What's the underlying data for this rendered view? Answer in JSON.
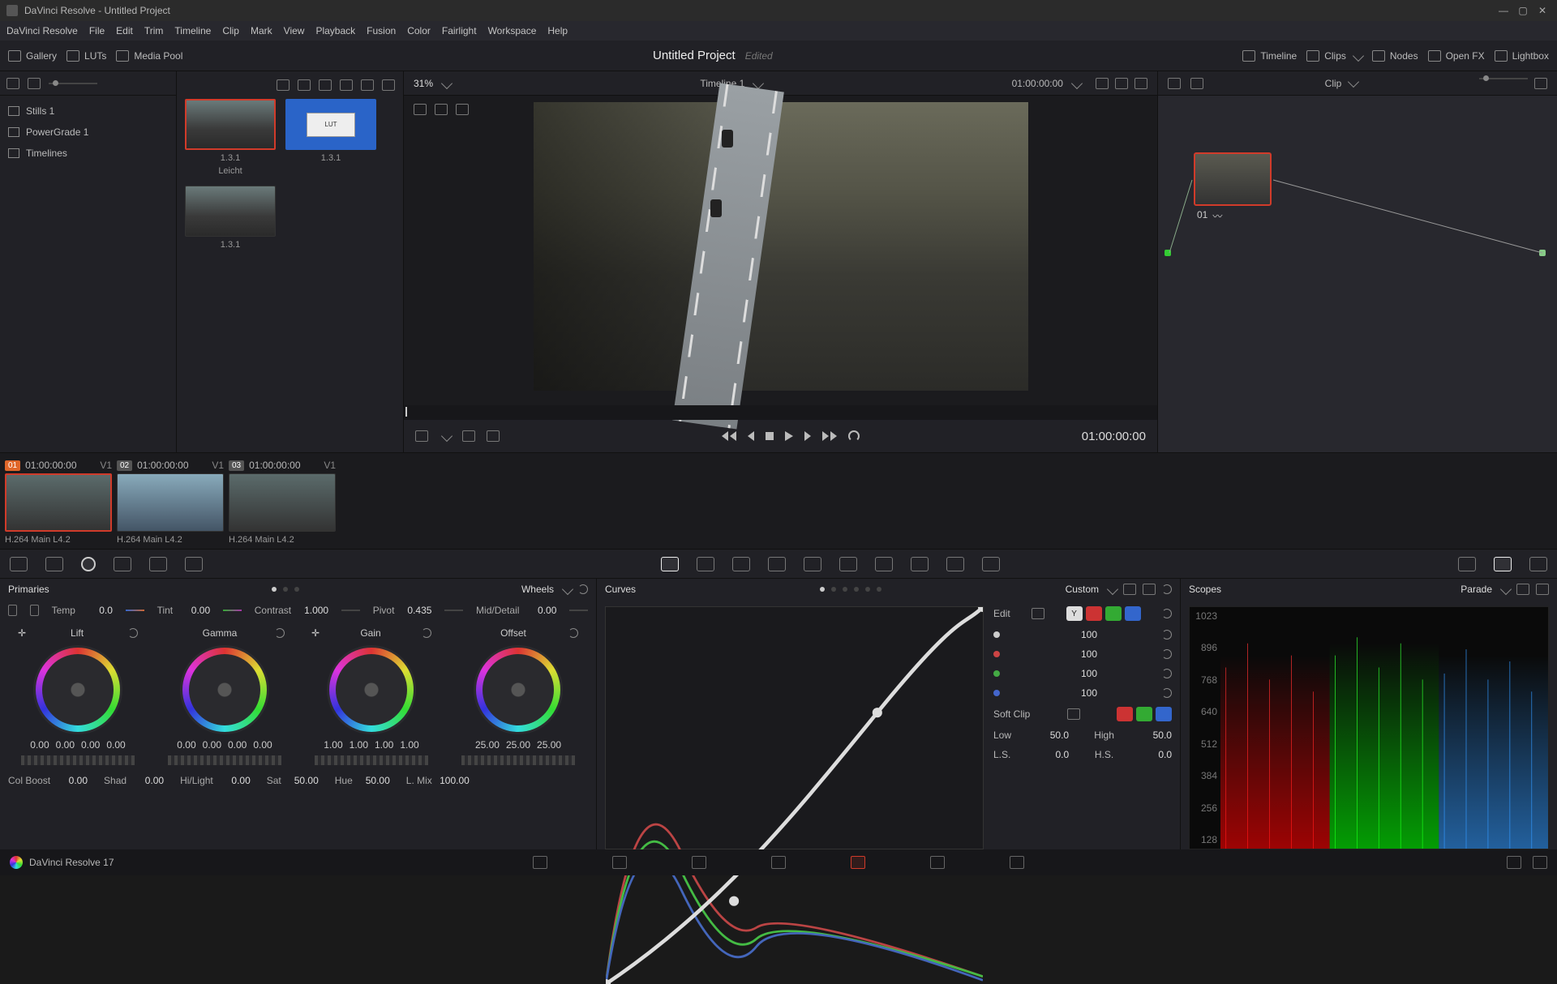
{
  "window": {
    "title": "DaVinci Resolve - Untitled Project"
  },
  "menu": [
    "DaVinci Resolve",
    "File",
    "Edit",
    "Trim",
    "Timeline",
    "Clip",
    "Mark",
    "View",
    "Playback",
    "Fusion",
    "Color",
    "Fairlight",
    "Workspace",
    "Help"
  ],
  "toolbar": {
    "gallery": "Gallery",
    "luts": "LUTs",
    "mediapool": "Media Pool",
    "timeline": "Timeline",
    "clips": "Clips",
    "nodes": "Nodes",
    "openfx": "Open FX",
    "lightbox": "Lightbox"
  },
  "project": {
    "title": "Untitled Project",
    "edited": "Edited"
  },
  "gallerySidebar": {
    "stills": "Stills 1",
    "powergrade": "PowerGrade 1",
    "timelines": "Timelines"
  },
  "viewer": {
    "zoom": "31%",
    "timeline": "Timeline 1",
    "tc": "01:00:00:00",
    "tc_big": "01:00:00:00"
  },
  "stills": [
    {
      "id": "1.3.1",
      "name": "Leicht"
    },
    {
      "id": "1.3.1"
    },
    {
      "id": "1.3.1"
    }
  ],
  "nodesPanel": {
    "mode": "Clip",
    "nodeLabel": "01"
  },
  "clips": [
    {
      "num": "01",
      "tc": "01:00:00:00",
      "track": "V1",
      "codec": "H.264 Main L4.2"
    },
    {
      "num": "02",
      "tc": "01:00:00:00",
      "track": "V1",
      "codec": "H.264 Main L4.2"
    },
    {
      "num": "03",
      "tc": "01:00:00:00",
      "track": "V1",
      "codec": "H.264 Main L4.2"
    }
  ],
  "primaries": {
    "title": "Primaries",
    "mode": "Wheels",
    "temp": {
      "label": "Temp",
      "val": "0.0"
    },
    "tint": {
      "label": "Tint",
      "val": "0.00"
    },
    "contrast": {
      "label": "Contrast",
      "val": "1.000"
    },
    "pivot": {
      "label": "Pivot",
      "val": "0.435"
    },
    "middetail": {
      "label": "Mid/Detail",
      "val": "0.00"
    },
    "wheels": {
      "lift": {
        "label": "Lift",
        "vals": [
          "0.00",
          "0.00",
          "0.00",
          "0.00"
        ]
      },
      "gamma": {
        "label": "Gamma",
        "vals": [
          "0.00",
          "0.00",
          "0.00",
          "0.00"
        ]
      },
      "gain": {
        "label": "Gain",
        "vals": [
          "1.00",
          "1.00",
          "1.00",
          "1.00"
        ]
      },
      "offset": {
        "label": "Offset",
        "vals": [
          "25.00",
          "25.00",
          "25.00"
        ]
      }
    },
    "bottom": {
      "colboost": {
        "label": "Col Boost",
        "val": "0.00"
      },
      "shad": {
        "label": "Shad",
        "val": "0.00"
      },
      "hilight": {
        "label": "Hi/Light",
        "val": "0.00"
      },
      "sat": {
        "label": "Sat",
        "val": "50.00"
      },
      "hue": {
        "label": "Hue",
        "val": "50.00"
      },
      "lmix": {
        "label": "L. Mix",
        "val": "100.00"
      }
    }
  },
  "curves": {
    "title": "Curves",
    "mode": "Custom",
    "edit": "Edit",
    "softclip": "Soft Clip",
    "chan": {
      "y": "100",
      "r": "100",
      "g": "100",
      "b": "100"
    },
    "low": {
      "label": "Low",
      "val": "50.0"
    },
    "high": {
      "label": "High",
      "val": "50.0"
    },
    "ls": {
      "label": "L.S.",
      "val": "0.0"
    },
    "hs": {
      "label": "H.S.",
      "val": "0.0"
    }
  },
  "scopes": {
    "title": "Scopes",
    "mode": "Parade",
    "ticks": [
      "1023",
      "896",
      "768",
      "640",
      "512",
      "384",
      "256",
      "128"
    ]
  },
  "footer": {
    "app": "DaVinci Resolve 17"
  }
}
